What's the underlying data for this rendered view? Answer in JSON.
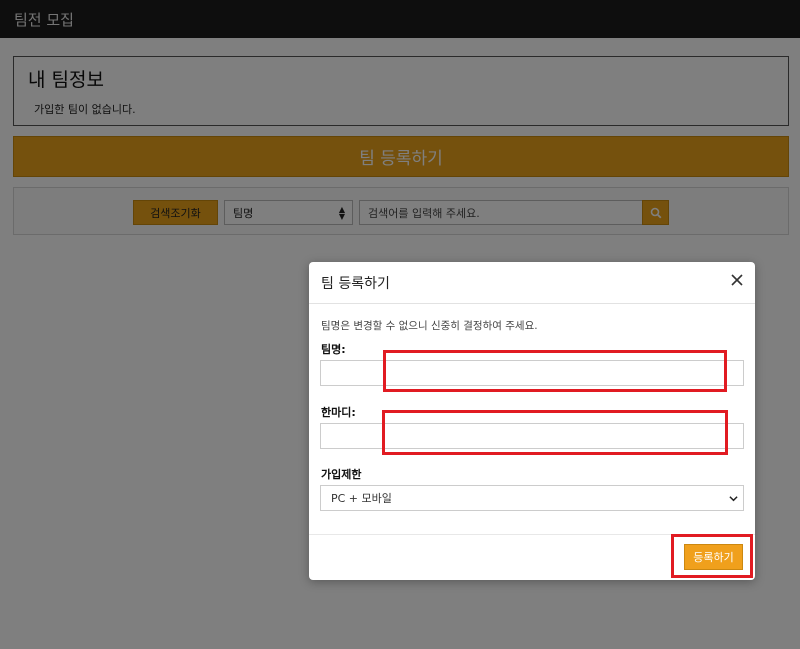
{
  "header": {
    "title": "팀전 모집"
  },
  "my_team": {
    "title": "내 팀정보",
    "message": "가입한 팀이 없습니다."
  },
  "register_bar": {
    "label": "팀 등록하기"
  },
  "search": {
    "reset_label": "검색조기화",
    "filter_selected": "팀명",
    "placeholder": "검색어를 입력해 주세요.",
    "button_icon": "search-icon"
  },
  "modal": {
    "title": "팀 등록하기",
    "close_icon": "close-icon",
    "notice": "팀명은 변경할 수 없으니 신중히 결정하여 주세요.",
    "team_name_label": "팀명:",
    "team_name_value": "",
    "comment_label": "한마디:",
    "comment_value": "",
    "join_limit_label": "가입제한",
    "join_limit_selected": "PC + 모바일",
    "submit_label": "등록하기"
  },
  "colors": {
    "accent": "#eaa21b",
    "topbar": "#1c1c1c",
    "highlight": "#e11b22"
  }
}
